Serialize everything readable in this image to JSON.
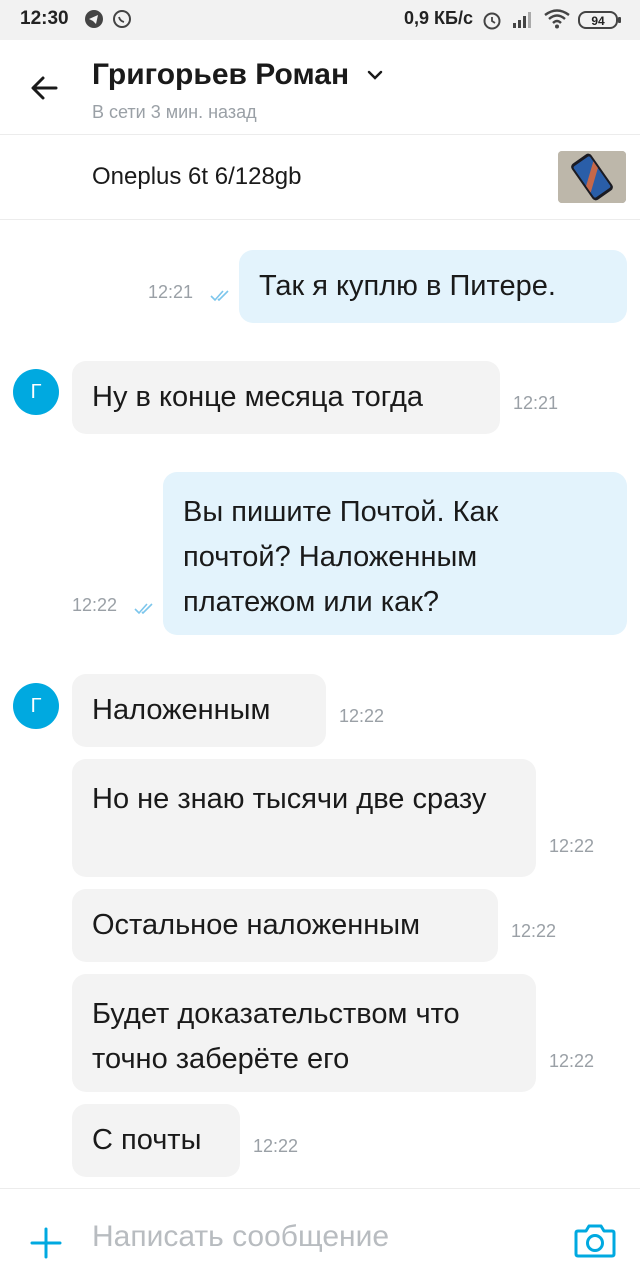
{
  "status_bar": {
    "time": "12:30",
    "network_speed": "0,9 КБ/с",
    "battery": "94",
    "icons": [
      "telegram-icon",
      "whatsapp-icon",
      "alarm-icon",
      "signal-icon",
      "wifi-icon",
      "battery-icon"
    ]
  },
  "header": {
    "name": "Григорьев Роман",
    "status": "В сети 3 мин. назад"
  },
  "listing": {
    "title": "Oneplus 6t 6/128gb"
  },
  "messages": [
    {
      "direction": "out",
      "text": "Так я куплю в Питере.",
      "time": "12:21",
      "read": true
    },
    {
      "direction": "in",
      "avatar": "Г",
      "text": "Ну в конце месяца тогда",
      "time": "12:21"
    },
    {
      "direction": "out",
      "text": "Вы пишите Почтой. Как почтой? Наложенным платежом или как?",
      "time": "12:22",
      "read": true
    },
    {
      "direction": "in",
      "avatar": "Г",
      "text": "Наложенным",
      "time": "12:22"
    },
    {
      "direction": "in",
      "text": "Но не знаю тысячи две сразу",
      "time": "12:22"
    },
    {
      "direction": "in",
      "text": "Остальное наложенным",
      "time": "12:22"
    },
    {
      "direction": "in",
      "text": "Будет доказательством что точно заберёте его",
      "time": "12:22"
    },
    {
      "direction": "in",
      "text": "С почты",
      "time": "12:22"
    }
  ],
  "composer": {
    "placeholder": "Написать сообщение"
  },
  "colors": {
    "accent": "#00a9e0",
    "outgoing_bubble": "#e3f3fc",
    "incoming_bubble": "#f3f3f3"
  }
}
